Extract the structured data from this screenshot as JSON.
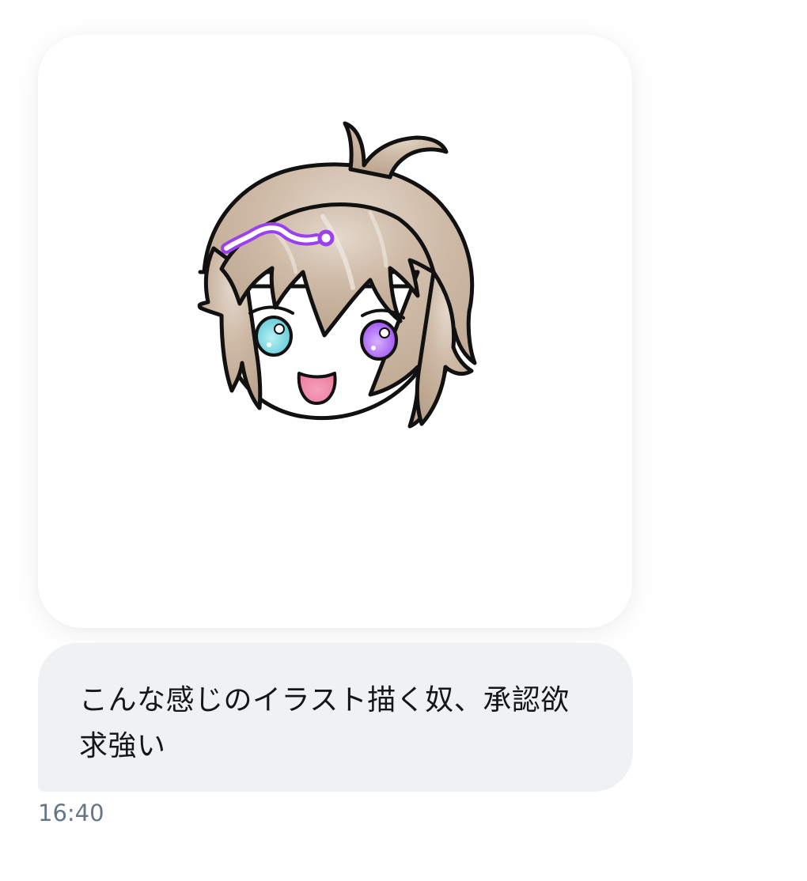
{
  "message": {
    "image": {
      "icon": "illustration-image",
      "subject": "chibi-character-drawing",
      "colors": {
        "hair": "#c8b39e",
        "outline": "#111111",
        "left_eye": "#6ad2dc",
        "right_eye": "#a14ff0",
        "hairclip": "#9b3ff0",
        "tongue": "#f17ba0"
      }
    },
    "text": "こんな感じのイラスト描く奴、承認欲求強い",
    "timestamp": "16:40"
  },
  "colors": {
    "bubble_background": "#eff1f3",
    "text": "#14171a",
    "timestamp": "#657786"
  }
}
